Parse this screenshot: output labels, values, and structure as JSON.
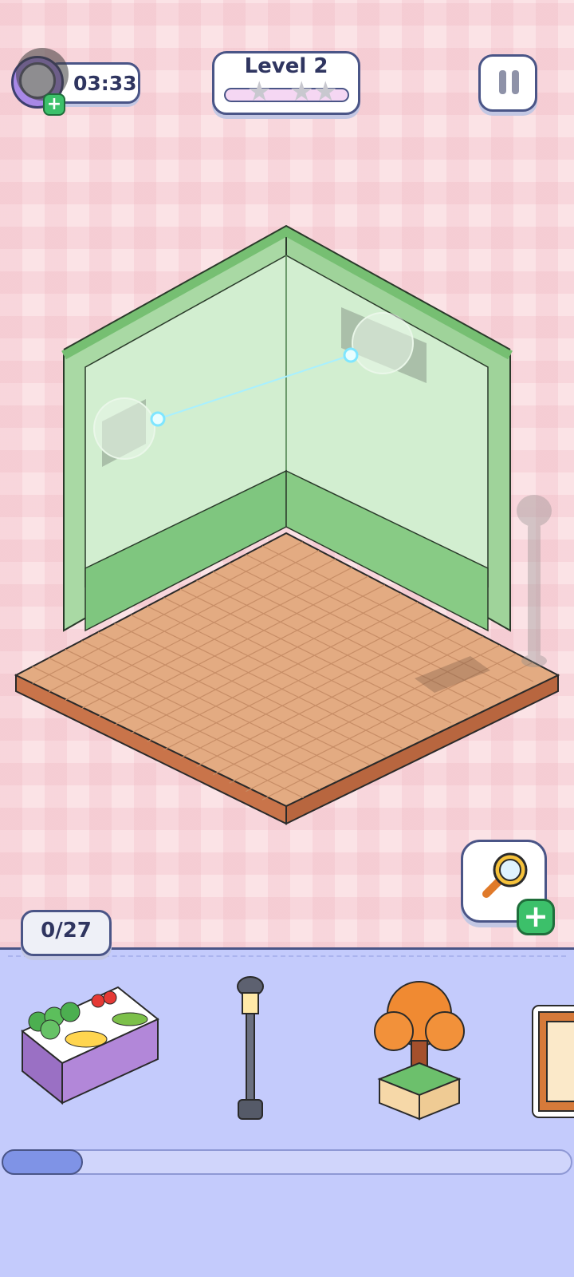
{
  "hud": {
    "timer": "03:33",
    "level_label": "Level 2",
    "stars_filled": 0,
    "stars_total": 3,
    "pause_icon": "pause-icon"
  },
  "boost": {
    "timer_boost_icon": "clock-icon",
    "hint_icon": "magnifier-icon",
    "add_icon": "plus-icon"
  },
  "inventory": {
    "placed_count": "0/27",
    "items": [
      {
        "name": "fruit-stand",
        "icon": "fruit-stand-icon"
      },
      {
        "name": "street-lamp",
        "icon": "street-lamp-icon"
      },
      {
        "name": "potted-tree",
        "icon": "potted-tree-icon"
      },
      {
        "name": "wooden-frame",
        "icon": "wooden-frame-icon"
      }
    ],
    "scroll_progress": 0.14
  },
  "colors": {
    "accent": "#4a5587",
    "wall": "#bfe6bf",
    "floor": "#d9a27a",
    "tray": "#c4cbfc",
    "plus": "#3cc06a"
  }
}
